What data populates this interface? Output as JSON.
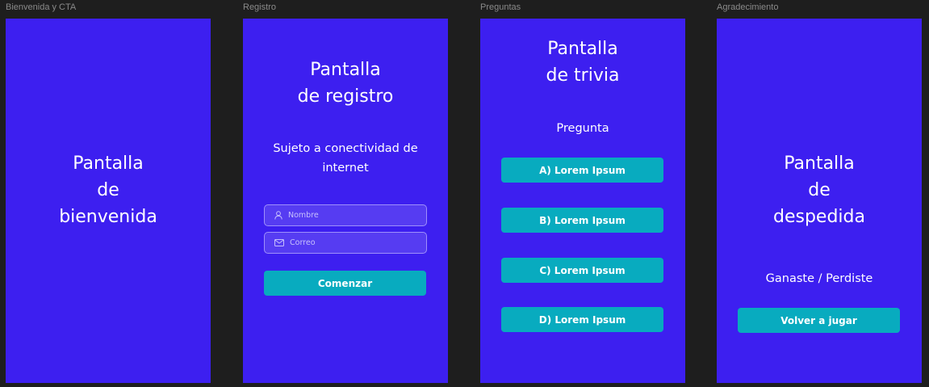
{
  "frames": {
    "welcome": {
      "label": "Bienvenida y CTA",
      "title_lines": [
        "Pantalla",
        "de",
        "bienvenida"
      ]
    },
    "register": {
      "label": "Registro",
      "title_lines": [
        "Pantalla",
        "de registro"
      ],
      "note_lines": [
        "Sujeto a conectividad de",
        "internet"
      ],
      "name_placeholder": "Nombre",
      "email_placeholder": "Correo",
      "start_button": "Comenzar"
    },
    "questions": {
      "label": "Preguntas",
      "title_lines": [
        "Pantalla",
        "de trivia"
      ],
      "question": "Pregunta",
      "answers": [
        "A) Lorem Ipsum",
        "B) Lorem Ipsum",
        "C) Lorem Ipsum",
        "D) Lorem Ipsum"
      ]
    },
    "thanks": {
      "label": "Agradecimiento",
      "title_lines": [
        "Pantalla",
        "de",
        "despedida"
      ],
      "result": "Ganaste / Perdiste",
      "replay_button": "Volver a jugar"
    }
  },
  "icons": {
    "name_field": "user-icon",
    "email_field": "mail-icon"
  },
  "colors": {
    "canvas": "#1e1e1e",
    "frame": "#3d1ff0",
    "button": "#08abbf",
    "text": "#ffffff",
    "frame_label": "#8a8a8a"
  }
}
